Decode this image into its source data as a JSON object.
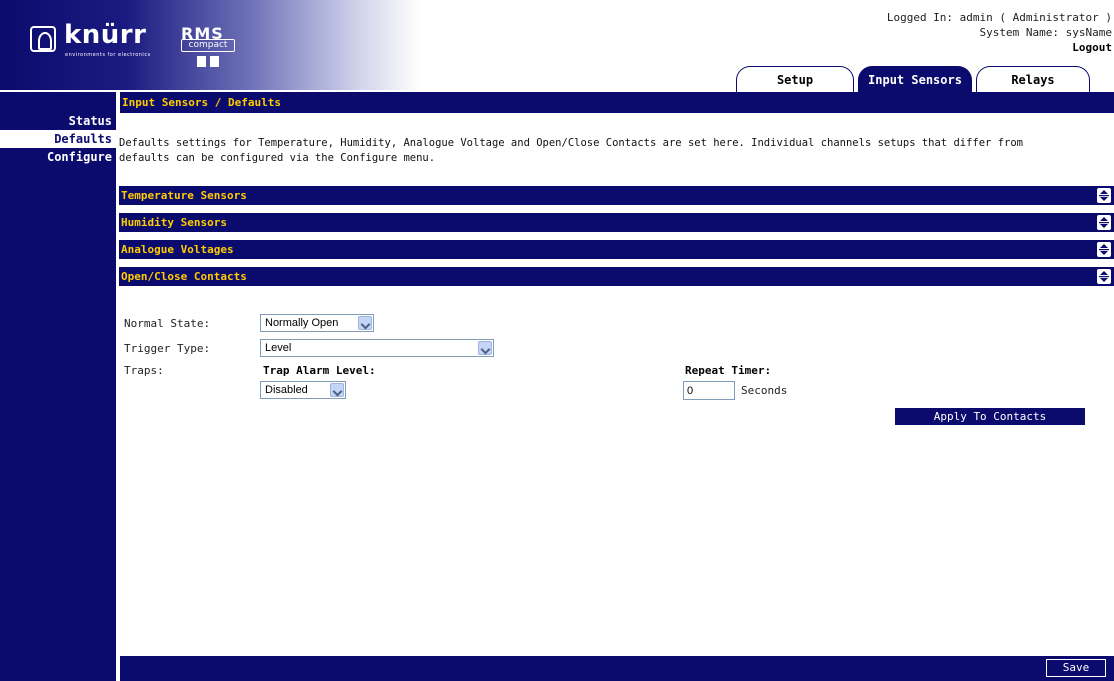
{
  "header": {
    "brand": "knürr",
    "brand_tagline": "environments for electronics",
    "product": "RMS",
    "product_sub": "compact",
    "logged_in": "Logged In: admin ( Administrator )",
    "system_name": "System Name: sysName",
    "logout": "Logout"
  },
  "tabs": [
    {
      "label": "Setup",
      "active": false
    },
    {
      "label": "Input Sensors",
      "active": true
    },
    {
      "label": "Relays",
      "active": false
    }
  ],
  "sidebar": {
    "items": [
      {
        "label": "Status",
        "active": false
      },
      {
        "label": "Defaults",
        "active": true
      },
      {
        "label": "Configure",
        "active": false
      }
    ]
  },
  "main": {
    "breadcrumb": "Input Sensors / Defaults",
    "intro": "Defaults settings for Temperature, Humidity, Analogue Voltage and Open/Close Contacts are set here. Individual channels setups that differ from defaults can be configured via the Configure menu.",
    "sections": [
      {
        "label": "Temperature Sensors"
      },
      {
        "label": "Humidity Sensors"
      },
      {
        "label": "Analogue Voltages"
      },
      {
        "label": "Open/Close Contacts"
      }
    ]
  },
  "contacts_form": {
    "normal_state_label": "Normal State:",
    "normal_state_value": "Normally Open",
    "trigger_type_label": "Trigger Type:",
    "trigger_type_value": "Level",
    "traps_label": "Traps:",
    "trap_alarm_label": "Trap Alarm Level:",
    "trap_alarm_value": "Disabled",
    "repeat_timer_label": "Repeat Timer:",
    "repeat_timer_value": "0",
    "seconds_label": "Seconds",
    "apply_label": "Apply To Contacts"
  },
  "footer": {
    "save_label": "Save"
  },
  "colors": {
    "navy": "#0b0b6e",
    "section_text": "#ffcc00"
  }
}
